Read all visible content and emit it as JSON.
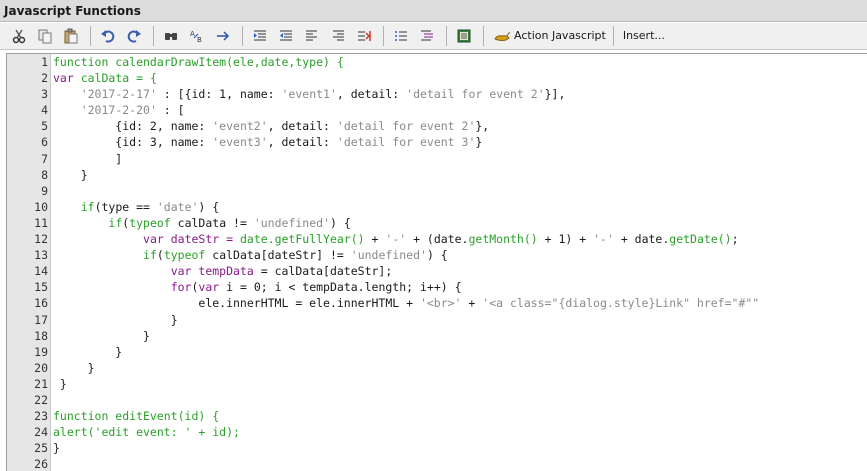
{
  "window": {
    "title": "Javascript Functions"
  },
  "toolbar": {
    "action_javascript_label": "Action Javascript",
    "insert_label": "Insert..."
  },
  "colors": {
    "keyword": "#8a1a8a",
    "string": "#8a8a8a",
    "function": "#2aa02a",
    "gutter": "#e6e6e6"
  },
  "code": {
    "lines": [
      [
        [
          "fn",
          "function calendarDrawItem(ele,date,type) {"
        ]
      ],
      [
        [
          "kw",
          "var"
        ],
        [
          "fn",
          " calData = {"
        ]
      ],
      [
        [
          "t",
          "    "
        ],
        [
          "str",
          "'2017-2-17'"
        ],
        [
          "t",
          " : [{id: 1, name: "
        ],
        [
          "str",
          "'event1'"
        ],
        [
          "t",
          ", detail: "
        ],
        [
          "str",
          "'detail for event 2'"
        ],
        [
          "t",
          "}],"
        ]
      ],
      [
        [
          "t",
          "    "
        ],
        [
          "str",
          "'2017-2-20'"
        ],
        [
          "t",
          " : ["
        ]
      ],
      [
        [
          "t",
          "         {id: 2, name: "
        ],
        [
          "str",
          "'event2'"
        ],
        [
          "t",
          ", detail: "
        ],
        [
          "str",
          "'detail for event 2'"
        ],
        [
          "t",
          "},"
        ]
      ],
      [
        [
          "t",
          "         {id: 3, name: "
        ],
        [
          "str",
          "'event3'"
        ],
        [
          "t",
          ", detail: "
        ],
        [
          "str",
          "'detail for event 3'"
        ],
        [
          "t",
          "}"
        ]
      ],
      [
        [
          "t",
          "         ]"
        ]
      ],
      [
        [
          "t",
          "    }"
        ]
      ],
      [
        [
          "t",
          ""
        ]
      ],
      [
        [
          "t",
          "    "
        ],
        [
          "fn",
          "if"
        ],
        [
          "t",
          "(type == "
        ],
        [
          "str",
          "'date'"
        ],
        [
          "t",
          ") {"
        ]
      ],
      [
        [
          "t",
          "        "
        ],
        [
          "fn",
          "if"
        ],
        [
          "t",
          "("
        ],
        [
          "fn",
          "typeof"
        ],
        [
          "t",
          " calData != "
        ],
        [
          "str",
          "'undefined'"
        ],
        [
          "t",
          ") {"
        ]
      ],
      [
        [
          "t",
          "             "
        ],
        [
          "kw",
          "var"
        ],
        [
          "kw",
          " dateStr = "
        ],
        [
          "fn",
          "date.getFullYear()"
        ],
        [
          "t",
          " + "
        ],
        [
          "str",
          "'-'"
        ],
        [
          "t",
          " + (date."
        ],
        [
          "fn",
          "getMonth()"
        ],
        [
          "t",
          " + 1) + "
        ],
        [
          "str",
          "'-'"
        ],
        [
          "t",
          " + date."
        ],
        [
          "fn",
          "getDate()"
        ],
        [
          "t",
          ";"
        ]
      ],
      [
        [
          "t",
          "             "
        ],
        [
          "fn",
          "if"
        ],
        [
          "t",
          "("
        ],
        [
          "fn",
          "typeof"
        ],
        [
          "t",
          " calData[dateStr] != "
        ],
        [
          "str",
          "'undefined'"
        ],
        [
          "t",
          ") {"
        ]
      ],
      [
        [
          "t",
          "                 "
        ],
        [
          "kw",
          "var"
        ],
        [
          "kw",
          " tempData"
        ],
        [
          "t",
          " = calData[dateStr];"
        ]
      ],
      [
        [
          "t",
          "                 "
        ],
        [
          "kw",
          "for"
        ],
        [
          "t",
          "("
        ],
        [
          "kw",
          "var"
        ],
        [
          "t",
          " i = 0; i < tempData.length; i++) {"
        ]
      ],
      [
        [
          "t",
          "                     ele.innerHTML = ele.innerHTML + "
        ],
        [
          "str",
          "'<br>'"
        ],
        [
          "t",
          " + "
        ],
        [
          "str",
          "'<a class=\"{dialog.style}Link\" href=\"#\"\""
        ]
      ],
      [
        [
          "t",
          "                 }"
        ]
      ],
      [
        [
          "t",
          "             }"
        ]
      ],
      [
        [
          "t",
          "         }"
        ]
      ],
      [
        [
          "t",
          "     }"
        ]
      ],
      [
        [
          "t",
          " }"
        ]
      ],
      [
        [
          "t",
          ""
        ]
      ],
      [
        [
          "fn",
          "function editEvent(id) {"
        ]
      ],
      [
        [
          "fn",
          "alert('edit event: ' + id);"
        ]
      ],
      [
        [
          "t",
          "}"
        ]
      ],
      [
        [
          "t",
          ""
        ]
      ]
    ]
  }
}
